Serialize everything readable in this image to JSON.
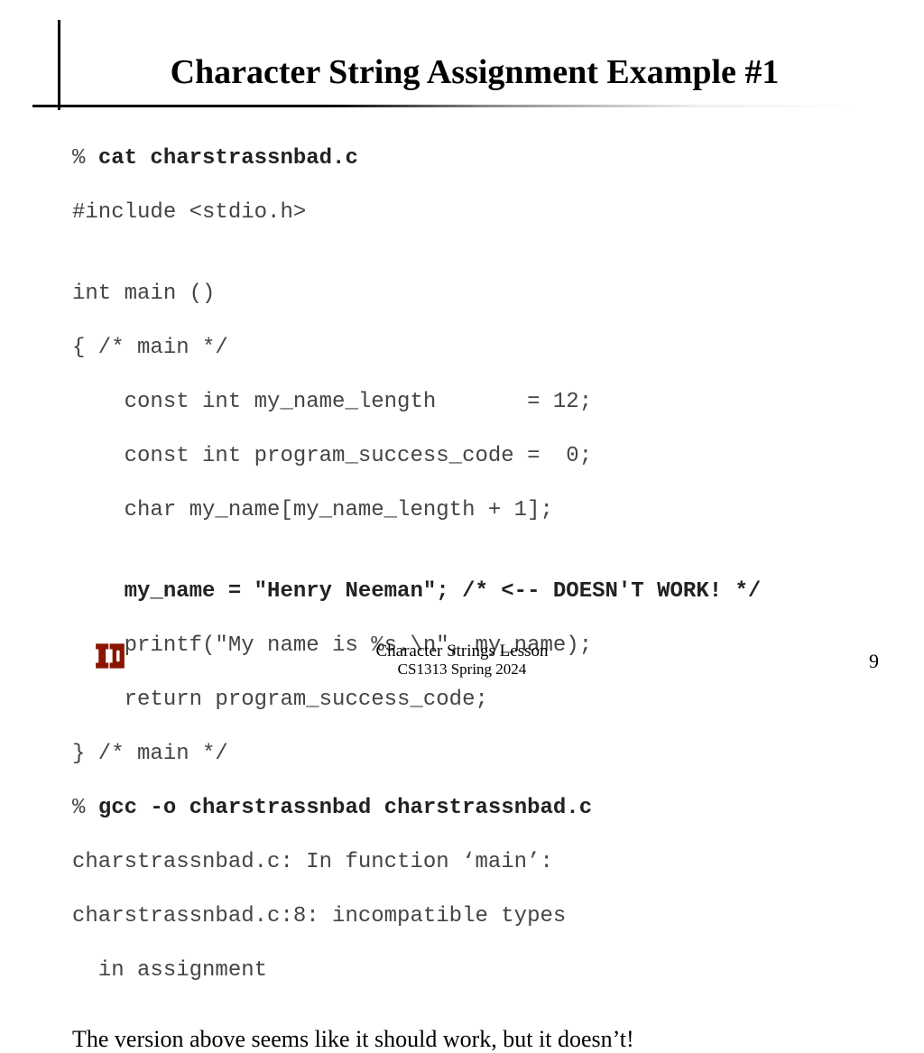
{
  "title": "Character String Assignment Example #1",
  "code": {
    "l1_prompt": "% ",
    "l1_cmd": "cat charstrassnbad.c",
    "l2": "#include <stdio.h>",
    "l3": "int main ()",
    "l4": "{ /* main */",
    "l5": "    const int my_name_length       = 12;",
    "l6": "    const int program_success_code =  0;",
    "l7": "    char my_name[my_name_length + 1];",
    "l8": "    my_name = \"Henry Neeman\"; /* <-- DOESN'T WORK! */",
    "l9": "    printf(\"My name is %s.\\n\", my_name);",
    "l10": "    return program_success_code;",
    "l11": "} /* main */",
    "l12_prompt": "% ",
    "l12_cmd": "gcc -o charstrassnbad charstrassnbad.c",
    "l13": "charstrassnbad.c: In function ‘main’:",
    "l14": "charstrassnbad.c:8: incompatible types",
    "l15": "  in assignment"
  },
  "commentary": "The version above seems like it should work, but it doesn’t!",
  "footer": {
    "lesson": "Character Strings Lesson",
    "course": "CS1313 Spring 2024",
    "page": "9"
  }
}
